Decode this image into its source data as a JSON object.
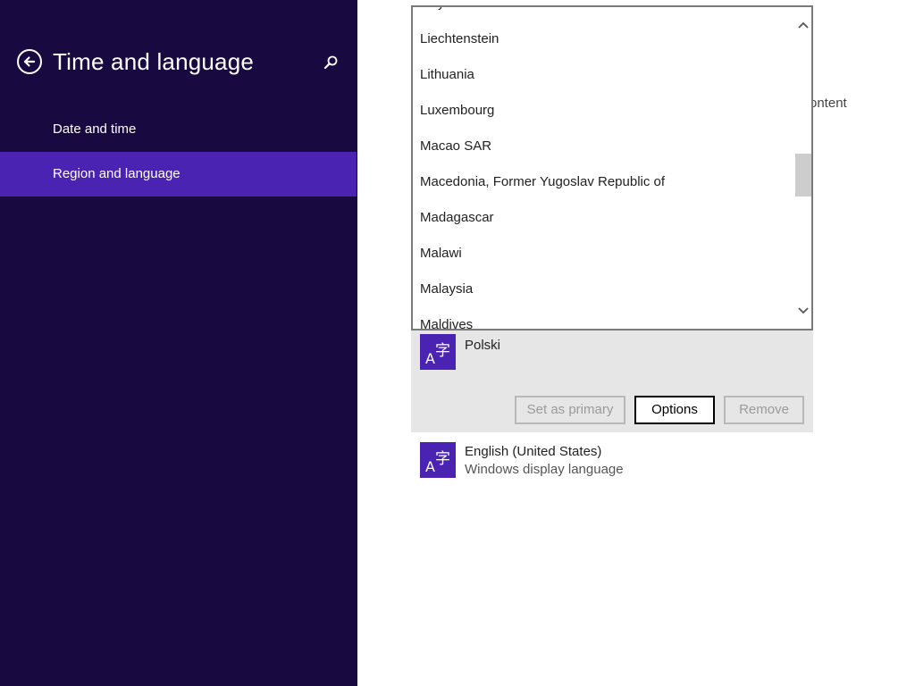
{
  "sidebar": {
    "title": "Time and language",
    "items": [
      {
        "label": "Date and time",
        "selected": false
      },
      {
        "label": "Region and language",
        "selected": true
      }
    ]
  },
  "main": {
    "partial_text": "ontent",
    "country_dropdown": {
      "items": [
        "Libya",
        "Liechtenstein",
        "Lithuania",
        "Luxembourg",
        "Macao SAR",
        "Macedonia, Former Yugoslav Republic of",
        "Madagascar",
        "Malawi",
        "Malaysia",
        "Maldives"
      ]
    },
    "languages": [
      {
        "name": "Polski",
        "buttons": {
          "set_primary": "Set as primary",
          "options": "Options",
          "remove": "Remove"
        }
      },
      {
        "name": "English (United States)",
        "subtitle": "Windows display language"
      }
    ]
  },
  "colors": {
    "sidebar_bg": "#190941",
    "accent": "#4b23b3"
  }
}
